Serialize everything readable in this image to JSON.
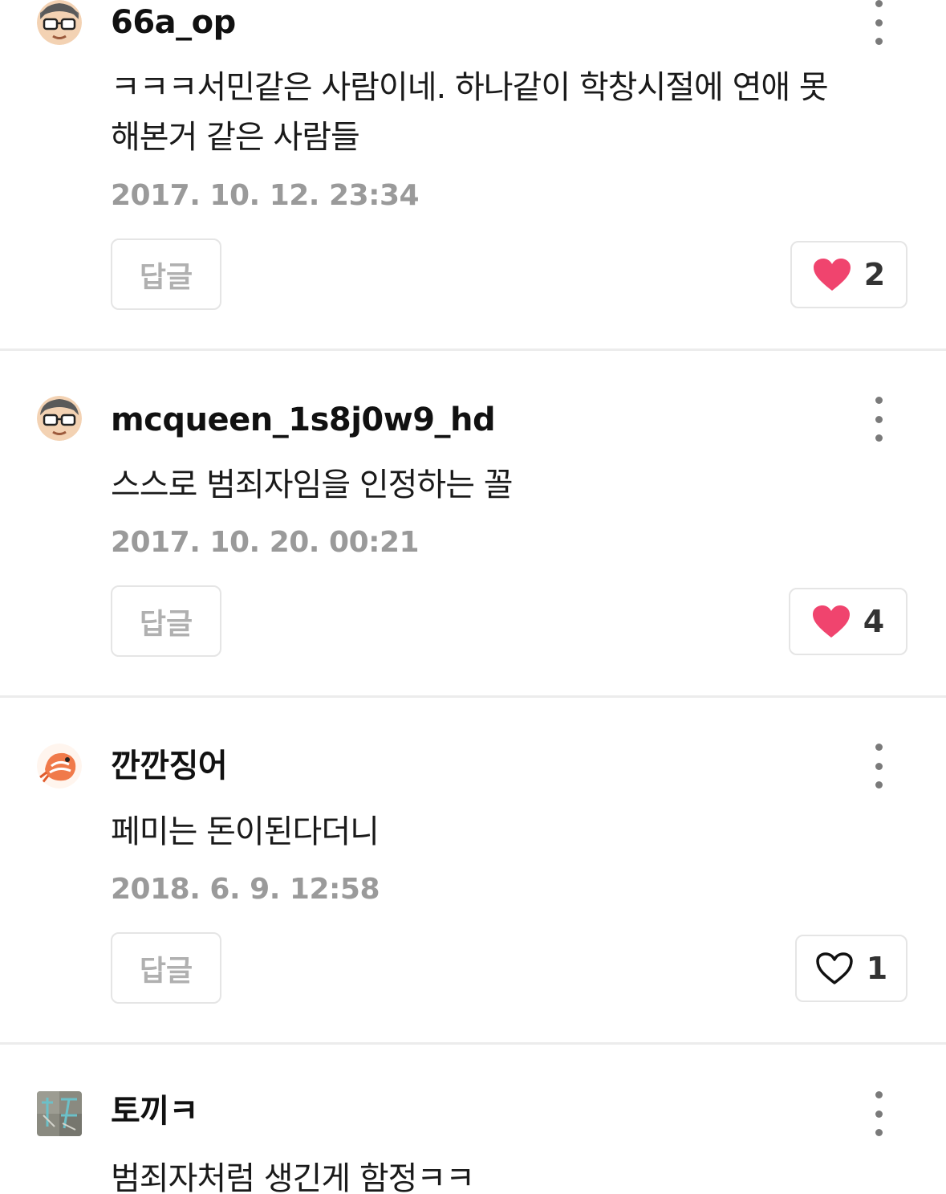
{
  "reply_label": "답글",
  "colors": {
    "heart_filled": "#f0446e",
    "heart_outline": "#111111",
    "date": "#9a9a9a",
    "divider": "#ececec"
  },
  "comments": [
    {
      "username": "66a_op",
      "avatar": "glasses-face-avatar",
      "text_lines": [
        "ㅋㅋㅋ서민같은 사람이네. 하나같이 학창시절에 연애 못",
        "해본거 같은 사람들"
      ],
      "date": "2017. 10. 12. 23:34",
      "likes": "2",
      "liked": true
    },
    {
      "username": "mcqueen_1s8j0w9_hd",
      "avatar": "glasses-face-avatar",
      "text_lines": [
        "스스로 범죄자임을 인정하는 꼴"
      ],
      "date": "2017. 10. 20. 00:21",
      "likes": "4",
      "liked": true
    },
    {
      "username": "깐깐징어",
      "avatar": "shrimp-avatar",
      "text_lines": [
        "페미는 돈이된다더니"
      ],
      "date": "2018. 6. 9. 12:58",
      "likes": "1",
      "liked": false
    },
    {
      "username": "토끼ㅋ",
      "avatar": "pattern-avatar",
      "text_lines": [
        "범죄자처럼 생긴게 함정ㅋㅋ"
      ],
      "date": "",
      "likes": "",
      "liked": false
    }
  ]
}
